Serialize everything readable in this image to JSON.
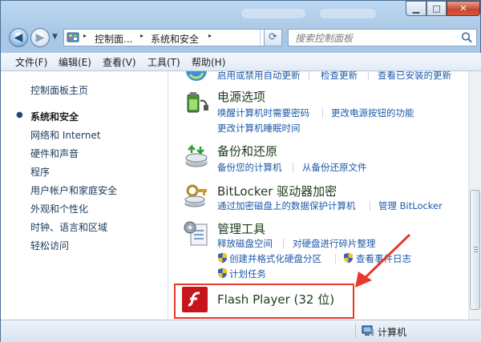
{
  "titlebar": {
    "minimize_glyph": "▁",
    "maximize_glyph": "□",
    "close_glyph": "✕"
  },
  "nav": {
    "back_icon": "arrow-left-icon",
    "forward_icon": "arrow-right-icon",
    "breadcrumb": [
      "控制面...",
      "系统和安全"
    ],
    "separator": "▸",
    "search_placeholder": "搜索控制面板"
  },
  "menubar": {
    "items": [
      "文件(F)",
      "编辑(E)",
      "查看(V)",
      "工具(T)",
      "帮助(H)"
    ]
  },
  "sidebar": {
    "items": [
      "控制面板主页",
      "系统和安全",
      "网络和 Internet",
      "硬件和声音",
      "程序",
      "用户帐户和家庭安全",
      "外观和个性化",
      "时钟、语言和区域",
      "轻松访问"
    ],
    "active_index": 1
  },
  "content": {
    "partial_links": [
      "启用或禁用自动更新",
      "检查更新",
      "查看已安装的更新"
    ],
    "power": {
      "title": "电源选项",
      "links": [
        "唤醒计算机时需要密码",
        "更改电源按钮的功能",
        "更改计算机睡眠时间"
      ]
    },
    "backup": {
      "title": "备份和还原",
      "links": [
        "备份您的计算机",
        "从备份还原文件"
      ]
    },
    "bitlocker": {
      "title": "BitLocker 驱动器加密",
      "links": [
        "通过加密磁盘上的数据保护计算机",
        "管理 BitLocker"
      ]
    },
    "admin": {
      "title": "管理工具",
      "links": [
        "释放磁盘空间",
        "对硬盘进行碎片整理",
        "创建并格式化硬盘分区",
        "查看事件日志",
        "计划任务"
      ]
    },
    "flash": {
      "title": "Flash Player (32 位)"
    }
  },
  "statusbar": {
    "label": "计算机",
    "icon": "computer-icon"
  },
  "colors": {
    "link": "#1e5aa8",
    "highlight": "#e8392d",
    "window_frame": "#a9c8e6"
  }
}
